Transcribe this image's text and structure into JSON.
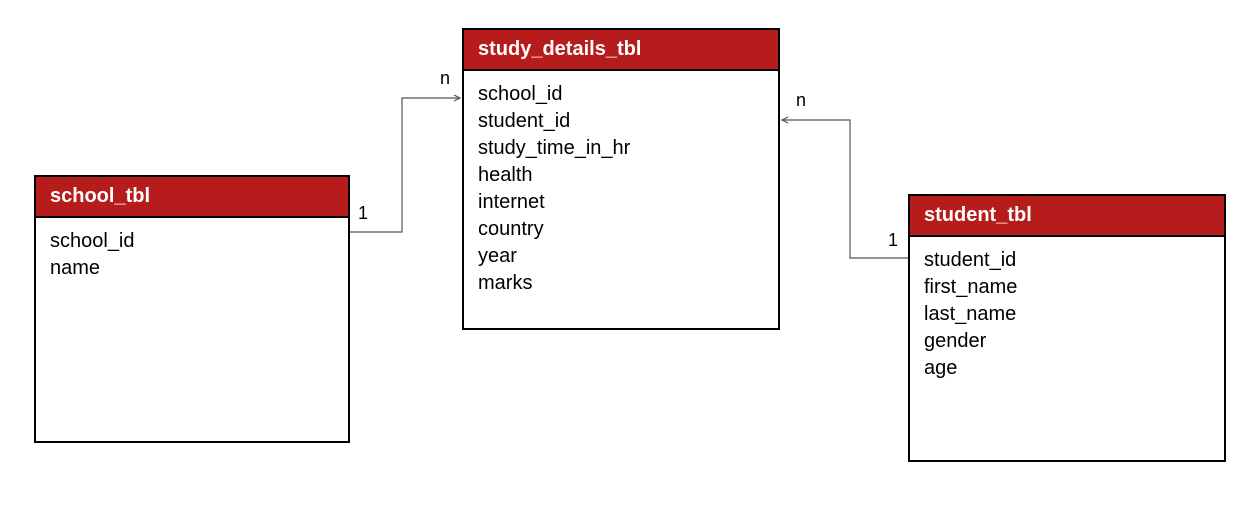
{
  "entities": {
    "school": {
      "title": "school_tbl",
      "fields": [
        "school_id",
        "name"
      ]
    },
    "study_details": {
      "title": "study_details_tbl",
      "fields": [
        "school_id",
        "student_id",
        "study_time_in_hr",
        "health",
        "internet",
        "country",
        "year",
        "marks"
      ]
    },
    "student": {
      "title": "student_tbl",
      "fields": [
        "student_id",
        "first_name",
        "last_name",
        "gender",
        "age"
      ]
    }
  },
  "relations": {
    "school_to_study": {
      "left_label": "1",
      "right_label": "n"
    },
    "study_to_student": {
      "left_label": "n",
      "right_label": "1"
    }
  }
}
